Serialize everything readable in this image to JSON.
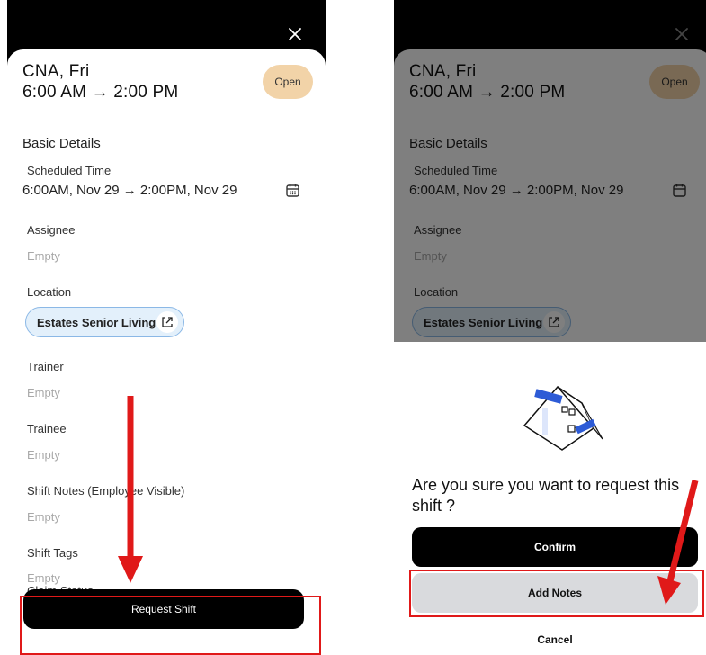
{
  "shift": {
    "title_line1": "CNA, Fri",
    "title_line2": "6:00 AM → 2:00 PM",
    "status_badge": "Open",
    "section_title": "Basic Details"
  },
  "fields": {
    "scheduled_time_label": "Scheduled Time",
    "scheduled_time_value": "6:00AM, Nov 29 → 2:00PM, Nov 29",
    "assignee_label": "Assignee",
    "assignee_value": "Empty",
    "location_label": "Location",
    "location_value": "Estates Senior Living",
    "trainer_label": "Trainer",
    "trainer_value": "Empty",
    "trainee_label": "Trainee",
    "trainee_value": "Empty",
    "shift_notes_label": "Shift Notes (Employee Visible)",
    "shift_notes_value": "Empty",
    "shift_tags_label": "Shift Tags",
    "shift_tags_value": "Empty",
    "claim_status_label": "Claim Status"
  },
  "actions": {
    "request_shift_label": "Request Shift"
  },
  "dialog": {
    "question": "Are you sure you want to request this shift ?",
    "confirm_label": "Confirm",
    "add_notes_label": "Add Notes",
    "cancel_label": "Cancel"
  },
  "icons": {
    "close": "close-icon",
    "calendar": "calendar-icon",
    "external_link": "external-link-icon",
    "illustration": "calendar-tent-illustration"
  },
  "colors": {
    "open_badge": "#f2d3a8",
    "location_chip_bg": "#e3f0fb",
    "location_chip_border": "#8bb8e6",
    "primary_button": "#000000",
    "secondary_button": "#d9dadd",
    "annotation_red": "#e01919"
  }
}
